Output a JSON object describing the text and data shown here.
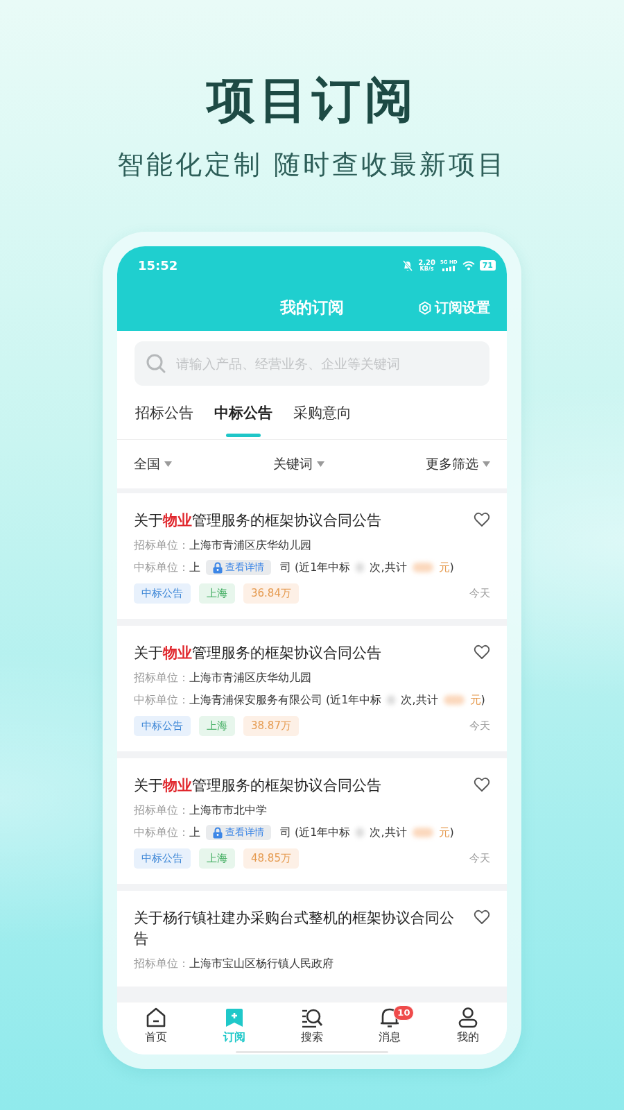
{
  "page": {
    "title": "项目订阅",
    "subtitle": "智能化定制 随时查收最新项目"
  },
  "status_bar": {
    "time": "15:52",
    "speed": "2.20",
    "speed_unit": "KB/s",
    "network": "5G HD",
    "battery": "71"
  },
  "header": {
    "title": "我的订阅",
    "action": "订阅设置"
  },
  "search": {
    "placeholder": "请输入产品、经营业务、企业等关键词"
  },
  "tabs": [
    {
      "label": "招标公告",
      "selected": false
    },
    {
      "label": "中标公告",
      "selected": true
    },
    {
      "label": "采购意向",
      "selected": false
    }
  ],
  "filters": [
    {
      "label": "全国"
    },
    {
      "label": "关键词"
    },
    {
      "label": "更多筛选"
    }
  ],
  "items": [
    {
      "title_parts": [
        {
          "text": "关于",
          "highlight": false
        },
        {
          "text": "物业",
          "highlight": true
        },
        {
          "text": "管理服务的框架协议合同公告",
          "highlight": false
        }
      ],
      "buyer_label": "招标单位：",
      "buyer": "上海市青浦区庆华幼儿园",
      "winner": {
        "label": "中标单位：",
        "kind": "locked",
        "prefix": "上",
        "lock_label": "查看详情",
        "suffix": "司",
        "stats": [
          "(近1年中标",
          "次,共计"
        ],
        "currency": "元",
        "close": ")"
      },
      "tags": [
        {
          "kind": "type",
          "text": "中标公告"
        },
        {
          "kind": "region",
          "text": "上海"
        },
        {
          "kind": "amount",
          "text": "36.84万"
        }
      ],
      "date": "今天"
    },
    {
      "title_parts": [
        {
          "text": "关于",
          "highlight": false
        },
        {
          "text": "物业",
          "highlight": true
        },
        {
          "text": "管理服务的框架协议合同公告",
          "highlight": false
        }
      ],
      "buyer_label": "招标单位：",
      "buyer": "上海市青浦区庆华幼儿园",
      "winner": {
        "label": "中标单位：",
        "kind": "plain",
        "name": "上海青浦保安服务有限公司",
        "stats": [
          "(近1年中标",
          "次,共计"
        ],
        "currency": "元",
        "close": ")"
      },
      "tags": [
        {
          "kind": "type",
          "text": "中标公告"
        },
        {
          "kind": "region",
          "text": "上海"
        },
        {
          "kind": "amount",
          "text": "38.87万"
        }
      ],
      "date": "今天"
    },
    {
      "title_parts": [
        {
          "text": "关于",
          "highlight": false
        },
        {
          "text": "物业",
          "highlight": true
        },
        {
          "text": "管理服务的框架协议合同公告",
          "highlight": false
        }
      ],
      "buyer_label": "招标单位：",
      "buyer": "上海市市北中学",
      "winner": {
        "label": "中标单位：",
        "kind": "locked",
        "prefix": "上",
        "lock_label": "查看详情",
        "suffix": "司",
        "stats": [
          "(近1年中标",
          "次,共计"
        ],
        "currency": "元",
        "close": ")"
      },
      "tags": [
        {
          "kind": "type",
          "text": "中标公告"
        },
        {
          "kind": "region",
          "text": "上海"
        },
        {
          "kind": "amount",
          "text": "48.85万"
        }
      ],
      "date": "今天"
    },
    {
      "title_parts": [
        {
          "text": "关于杨行镇社建办采购台式整机的框架协议合同公告",
          "highlight": false
        }
      ],
      "buyer_label": "招标单位：",
      "buyer": "上海市宝山区杨行镇人民政府"
    }
  ],
  "nav": [
    {
      "label": "首页",
      "kind": "home",
      "selected": false
    },
    {
      "label": "订阅",
      "kind": "subscribe",
      "selected": true
    },
    {
      "label": "搜索",
      "kind": "search",
      "selected": false
    },
    {
      "label": "消息",
      "kind": "bell",
      "selected": false,
      "badge": "10"
    },
    {
      "label": "我的",
      "kind": "user",
      "selected": false
    }
  ]
}
